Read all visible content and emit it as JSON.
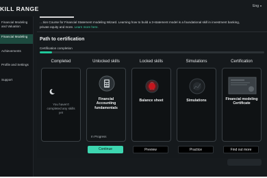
{
  "app": {
    "logo": "KILL RANGE",
    "language": "Eng"
  },
  "sidebar": {
    "items": [
      {
        "label": "Financial Modeling and Valuation"
      },
      {
        "label": "Financial Modeling"
      },
      {
        "label": "Achievements"
      },
      {
        "label": "Profile and Settings"
      },
      {
        "label": "Support"
      }
    ]
  },
  "intro": {
    "text": "…tion Course for Financial Statement modeling Wizard. Learning how to build a 3-statement model is a foundational skill in investment banking, private equity and more.",
    "more": "Learn more here."
  },
  "certification": {
    "title": "Path to certification",
    "progress_label": "Certification completion",
    "progress_fraction": 0.055
  },
  "columns": [
    {
      "heading": "Completed",
      "card_text": "You haven't completed any skills yet",
      "icon": "moon-icon"
    },
    {
      "heading": "Unlocked skills",
      "card_text": "Financial Accounting fundamentals",
      "status": "In Progress",
      "icon": "calculator-icon"
    },
    {
      "heading": "Locked skills",
      "card_text": "Balance sheet",
      "icon": "lock-icon"
    },
    {
      "heading": "Simulations",
      "card_text": "Simulations",
      "icon": "simulation-icon"
    },
    {
      "heading": "Certification",
      "card_text": "Financial modeling Certificate",
      "icon": "certificate-icon"
    }
  ],
  "buttons": [
    {
      "label": "Continue",
      "style": "primary"
    },
    {
      "label": "Preview",
      "style": "secondary"
    },
    {
      "label": "Practice",
      "style": "secondary"
    },
    {
      "label": "Find out more",
      "style": "secondary"
    }
  ],
  "colors": {
    "accent": "#3dd6b0",
    "background": "#161a1d",
    "card": "#0f1214",
    "active_sidebar": "#1d4a3f",
    "cursor": "#c4161e"
  }
}
